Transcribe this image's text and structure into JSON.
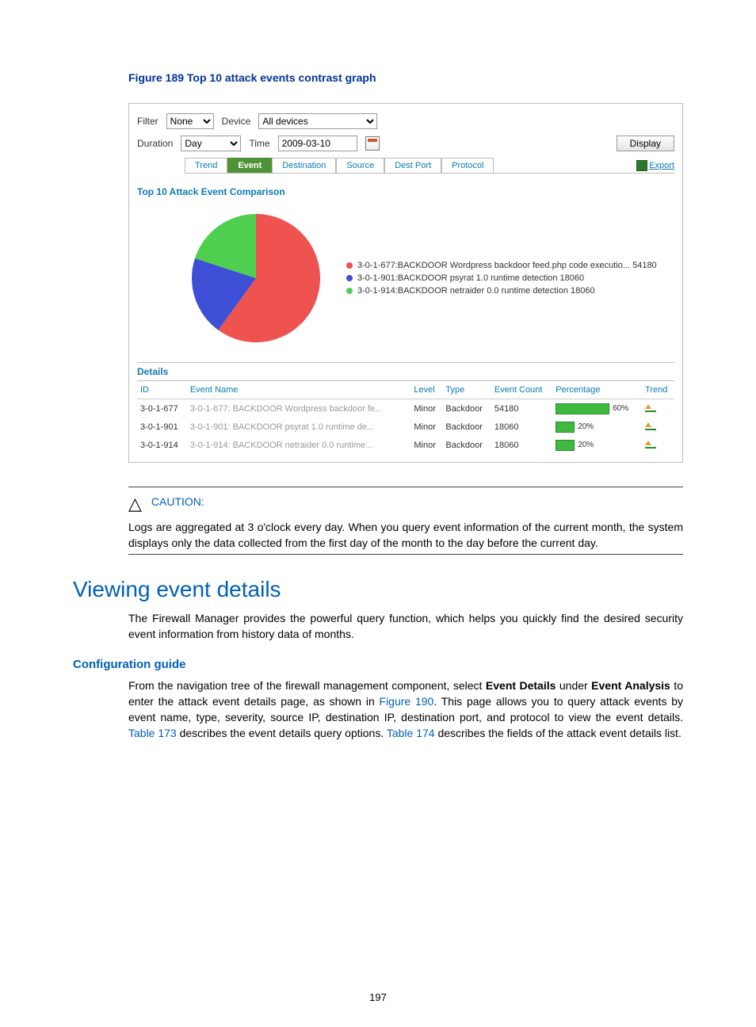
{
  "figure_caption": "Figure 189 Top 10 attack events contrast graph",
  "filters": {
    "filter_label": "Filter",
    "filter_value": "None",
    "device_label": "Device",
    "device_value": "All devices",
    "duration_label": "Duration",
    "duration_value": "Day",
    "time_label": "Time",
    "time_value": "2009-03-10",
    "display_button": "Display"
  },
  "tabs": [
    "Trend",
    "Event",
    "Destination",
    "Source",
    "Dest Port",
    "Protocol"
  ],
  "active_tab_index": 1,
  "export_label": "Export",
  "chart_title": "Top 10 Attack Event Comparison",
  "chart_data": {
    "type": "pie",
    "title": "Top 10 Attack Event Comparison",
    "series": [
      {
        "name": "3-0-1-677:BACKDOOR Wordpress backdoor feed.php code executio... 54180",
        "value": 54180,
        "pct": 60,
        "color": "#ef5350"
      },
      {
        "name": "3-0-1-901:BACKDOOR psyrat 1.0 runtime detection 18060",
        "value": 18060,
        "pct": 20,
        "color": "#3d4fd4"
      },
      {
        "name": "3-0-1-914:BACKDOOR netraider 0.0 runtime detection 18060",
        "value": 18060,
        "pct": 20,
        "color": "#4fcf4f"
      }
    ]
  },
  "details_header": "Details",
  "details_columns": [
    "ID",
    "Event Name",
    "Level",
    "Type",
    "Event Count",
    "Percentage",
    "Trend"
  ],
  "details_rows": [
    {
      "id": "3-0-1-677",
      "name": "3-0-1-677: BACKDOOR Wordpress backdoor fe...",
      "level": "Minor",
      "type": "Backdoor",
      "count": "54180",
      "pct": "60%",
      "pct_w": 60
    },
    {
      "id": "3-0-1-901",
      "name": "3-0-1-901: BACKDOOR psyrat 1.0 runtime de...",
      "level": "Minor",
      "type": "Backdoor",
      "count": "18060",
      "pct": "20%",
      "pct_w": 20
    },
    {
      "id": "3-0-1-914",
      "name": "3-0-1-914: BACKDOOR netraider 0.0 runtime...",
      "level": "Minor",
      "type": "Backdoor",
      "count": "18060",
      "pct": "20%",
      "pct_w": 20
    }
  ],
  "caution": {
    "title": "CAUTION:",
    "body": "Logs are aggregated at 3 o'clock every day. When you query event information of the current month, the system displays only the data collected from the first day of the month to the day before the current day."
  },
  "section_heading": "Viewing event details",
  "section_intro": "The Firewall Manager provides the powerful query function, which helps you quickly find the desired security event information from history data of months.",
  "config_heading": "Configuration guide",
  "config_para": {
    "p1a": "From the navigation tree of the firewall management component, select ",
    "b1": "Event Details",
    "p1b": " under ",
    "b2": "Event Analysis",
    "p1c": " to enter the attack event details page, as shown in ",
    "l1": "Figure 190",
    "p1d": ". This page allows you to query attack events by event name, type, severity, source IP, destination IP, destination port, and protocol to view the event details. ",
    "l2": "Table 173",
    "p1e": " describes the event details query options. ",
    "l3": "Table 174",
    "p1f": " describes the fields of the attack event details list."
  },
  "page_number": "197"
}
